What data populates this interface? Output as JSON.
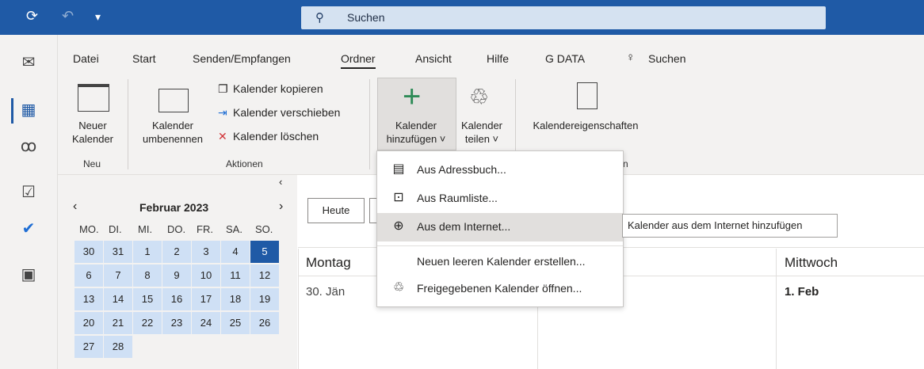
{
  "titlebar": {
    "search_placeholder": "Suchen"
  },
  "menu": [
    "Datei",
    "Start",
    "Senden/Empfangen",
    "Ordner",
    "Ansicht",
    "Hilfe",
    "G DATA"
  ],
  "menu_search": "Suchen",
  "ribbon": {
    "neuer_kalender": "Neuer\nKalender",
    "kalender_umbenennen": "Kalender\numbenennen",
    "kalender_kopieren": "Kalender kopieren",
    "kalender_verschieben": "Kalender verschieben",
    "kalender_loeschen": "Kalender löschen",
    "kalender_hinzufuegen": "Kalender\nhinzufügen ˅",
    "kalender_teilen": "Kalender\nteilen ˅",
    "kalendereigenschaften": "Kalendereigenschaften",
    "group_neu": "Neu",
    "group_aktionen": "Aktionen",
    "group_hidden": "n"
  },
  "minical": {
    "title": "Februar 2023",
    "weekdays": [
      "MO.",
      "DI.",
      "MI.",
      "DO.",
      "FR.",
      "SA.",
      "SO."
    ],
    "rows": [
      [
        "30",
        "31",
        "1",
        "2",
        "3",
        "4",
        "5"
      ],
      [
        "6",
        "7",
        "8",
        "9",
        "10",
        "11",
        "12"
      ],
      [
        "13",
        "14",
        "15",
        "16",
        "17",
        "18",
        "19"
      ],
      [
        "20",
        "21",
        "22",
        "23",
        "24",
        "25",
        "26"
      ],
      [
        "27",
        "28",
        "",
        "",
        "",
        "",
        ""
      ]
    ],
    "selected": "5"
  },
  "main": {
    "today_label": "Heute",
    "col1_header": "Montag",
    "col1_date": "30. Jän",
    "col3_header": "Mittwoch",
    "col3_date": "1. Feb"
  },
  "dropdown": [
    {
      "label": "Aus Adressbuch...",
      "icon": "addressbook-icon"
    },
    {
      "label": "Aus Raumliste...",
      "icon": "roomlist-icon"
    },
    {
      "label": "Aus dem Internet...",
      "icon": "globe-icon"
    },
    {
      "label": "Neuen leeren Kalender erstellen...",
      "icon": ""
    },
    {
      "label": "Freigegebenen Kalender öffnen...",
      "icon": "share-icon"
    }
  ],
  "tooltip": "Kalender aus dem Internet hinzufügen",
  "colors": {
    "titlebar": "#1f5aa6",
    "selected_day": "#1f5aa6",
    "range_bg": "#cfe0f5",
    "hover": "#e1dfdd"
  }
}
